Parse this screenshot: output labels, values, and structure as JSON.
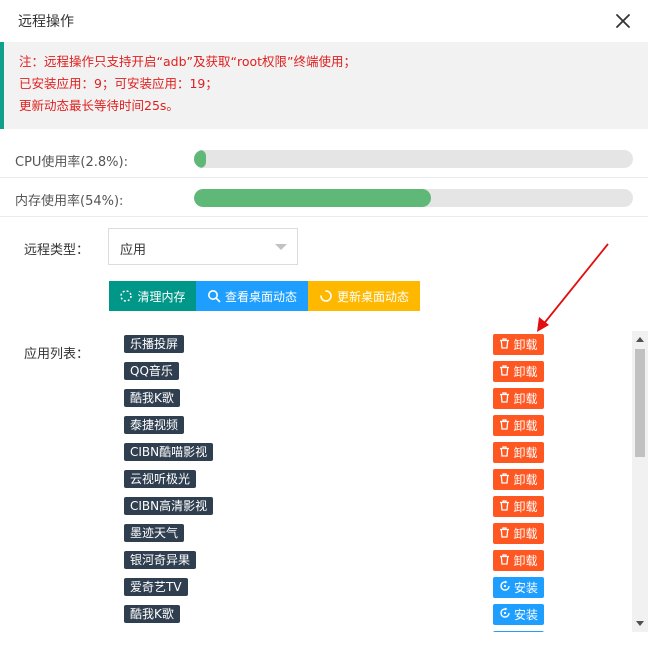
{
  "dialog": {
    "title": "远程操作"
  },
  "notice": {
    "lines": [
      "注：远程操作只支持开启“adb”及获取“root权限”终端使用；",
      "已安装应用：9；可安装应用：19；",
      "更新动态最长等待时间25s。"
    ],
    "accent_color": "#0f9f8b",
    "text_color": "#e02020"
  },
  "metrics": {
    "cpu": {
      "label": "CPU使用率(2.8%):",
      "percent": 2.8
    },
    "memory": {
      "label": "内存使用率(54%):",
      "percent": 54
    }
  },
  "remote_type": {
    "label": "远程类型：",
    "value": "应用"
  },
  "buttons": {
    "clear": {
      "label": "清理内存",
      "color": "#009688"
    },
    "view": {
      "label": "查看桌面动态",
      "color": "#1e9fff"
    },
    "update": {
      "label": "更新桌面动态",
      "color": "#ffb800"
    }
  },
  "app_list": {
    "label": "应用列表：",
    "items": [
      {
        "name": "乐播投屏",
        "action": "卸载",
        "type": "uninstall"
      },
      {
        "name": "QQ音乐",
        "action": "卸载",
        "type": "uninstall"
      },
      {
        "name": "酷我K歌",
        "action": "卸载",
        "type": "uninstall"
      },
      {
        "name": "泰捷视频",
        "action": "卸载",
        "type": "uninstall"
      },
      {
        "name": "CIBN酷喵影视",
        "action": "卸载",
        "type": "uninstall"
      },
      {
        "name": "云视听极光",
        "action": "卸载",
        "type": "uninstall"
      },
      {
        "name": "CIBN高清影视",
        "action": "卸载",
        "type": "uninstall"
      },
      {
        "name": "墨迹天气",
        "action": "卸载",
        "type": "uninstall"
      },
      {
        "name": "银河奇异果",
        "action": "卸载",
        "type": "uninstall"
      },
      {
        "name": "爱奇艺TV",
        "action": "安装",
        "type": "install"
      },
      {
        "name": "酷我K歌",
        "action": "安装",
        "type": "install"
      }
    ]
  },
  "colors": {
    "uninstall": "#ff5722",
    "install": "#1e9fff",
    "progress": "#5fb878",
    "annotation": "#e01010"
  }
}
